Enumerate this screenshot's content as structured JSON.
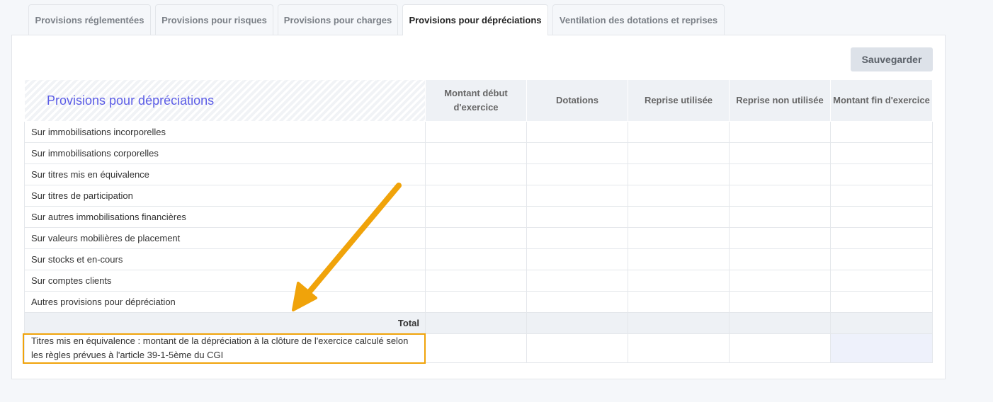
{
  "tabs": [
    {
      "label": "Provisions réglementées",
      "active": false
    },
    {
      "label": "Provisions pour risques",
      "active": false
    },
    {
      "label": "Provisions pour charges",
      "active": false
    },
    {
      "label": "Provisions pour dépréciations",
      "active": true
    },
    {
      "label": "Ventilation des dotations et reprises",
      "active": false
    }
  ],
  "toolbar": {
    "save_label": "Sauvegarder"
  },
  "table": {
    "title": "Provisions pour dépréciations",
    "columns": [
      "Montant début d'exercice",
      "Dotations",
      "Reprise utilisée",
      "Reprise non utilisée",
      "Montant fin d'exercice"
    ],
    "rows": [
      "Sur immobilisations incorporelles",
      "Sur immobilisations corporelles",
      "Sur titres mis en équivalence",
      "Sur titres de participation",
      "Sur autres immobilisations financières",
      "Sur valeurs mobilières de placement",
      "Sur stocks et en-cours",
      "Sur comptes clients",
      "Autres provisions pour dépréciation"
    ],
    "total_label": "Total",
    "note_label": "Titres mis en équivalence : montant de la dépréciation à la clôture de l'exercice calculé selon les règles prévues à l'article 39-1-5ème du CGI"
  },
  "annotation": {
    "color": "#f0a30a"
  }
}
